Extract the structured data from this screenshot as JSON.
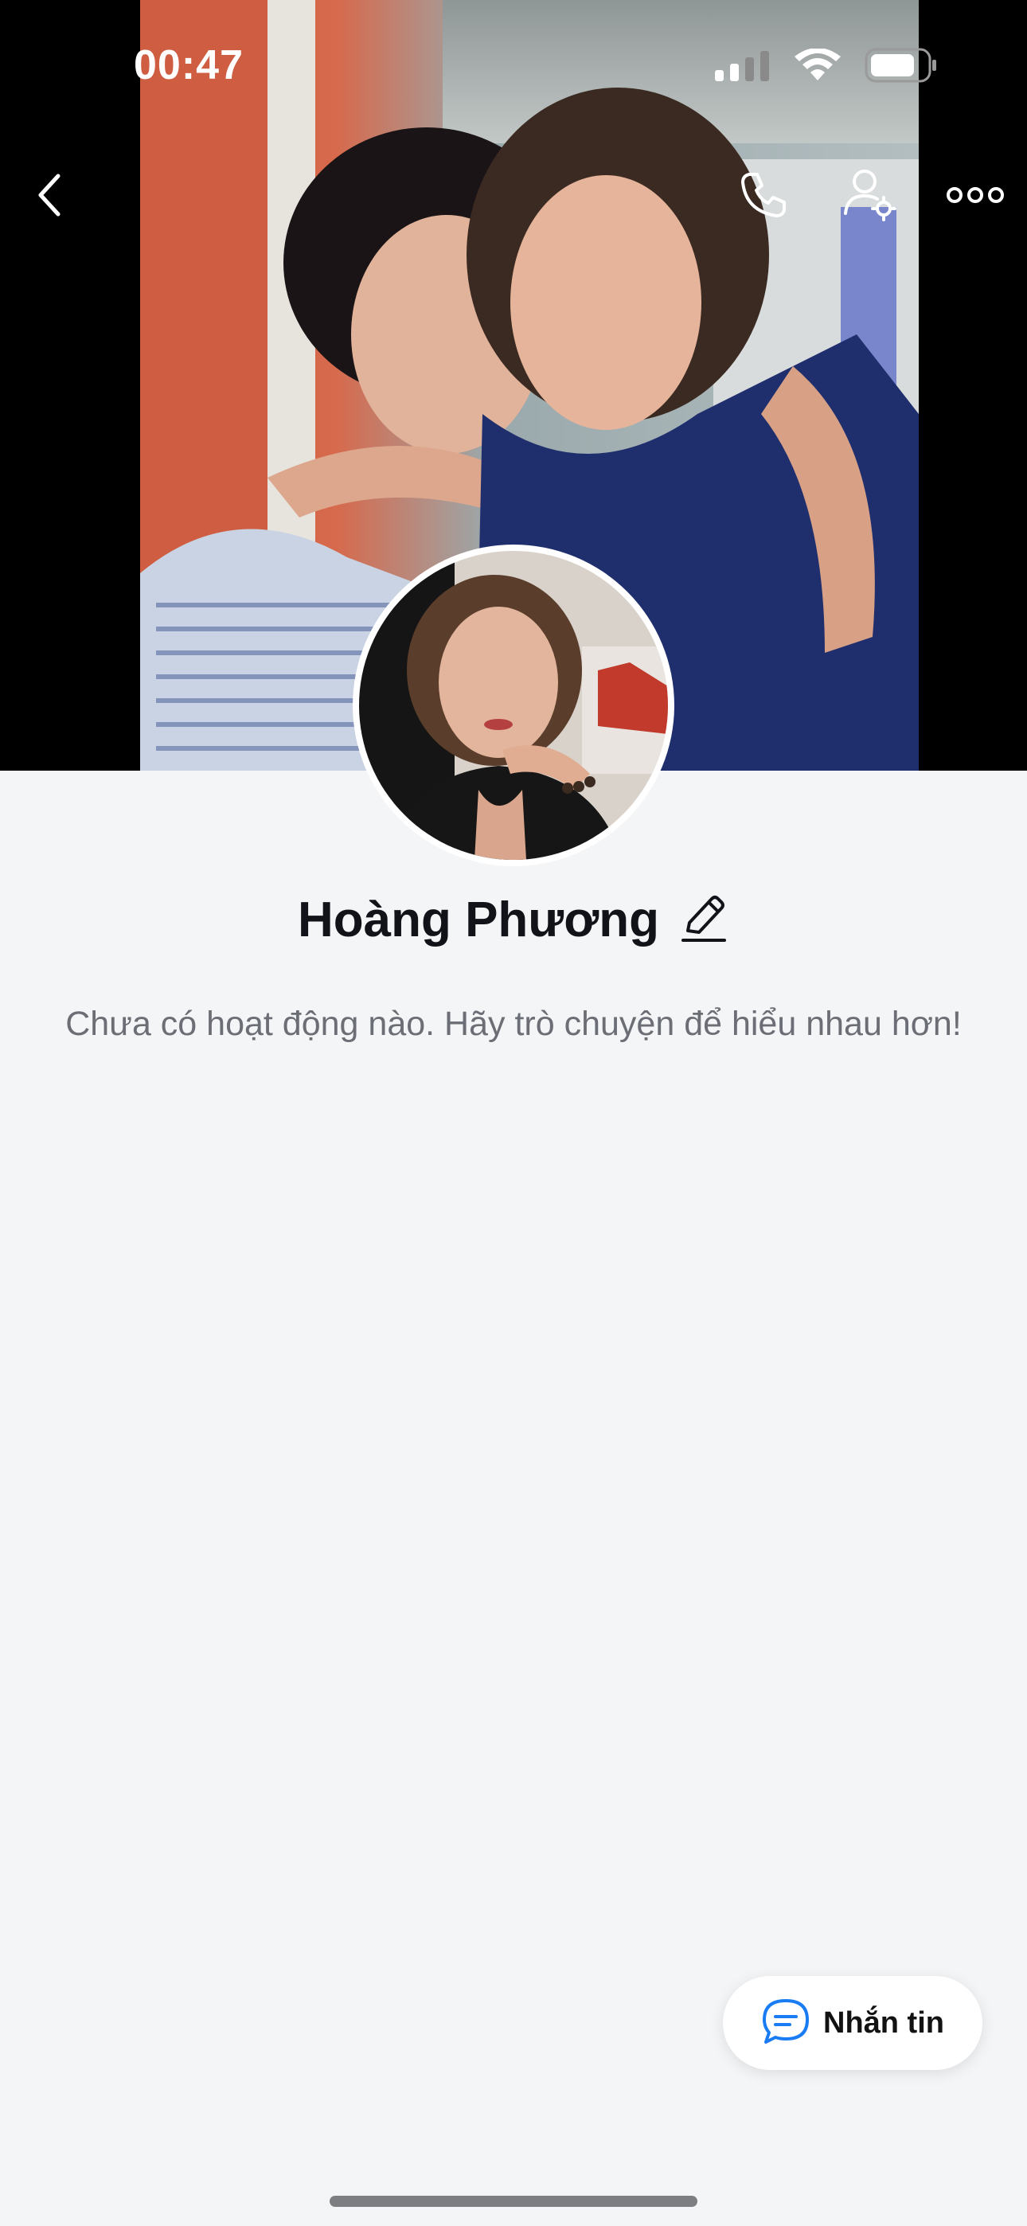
{
  "status_bar": {
    "time": "00:47",
    "icons": [
      "signal-icon",
      "wifi-icon",
      "battery-icon"
    ]
  },
  "top_nav": {
    "back_icon": "back-chevron-icon",
    "call_icon": "phone-icon",
    "settings_icon": "user-settings-icon",
    "more_icon": "more-icon"
  },
  "profile": {
    "name": "Hoàng Phương",
    "edit_icon": "pencil-icon",
    "empty_message": "Chưa có hoạt động nào. Hãy trò chuyện để hiểu nhau hơn!"
  },
  "actions": {
    "message_label": "Nhắn tin",
    "message_icon": "chat-bubble-icon"
  },
  "colors": {
    "accent": "#1a7cf2",
    "background": "#f4f5f7",
    "cover_bg": "#000000"
  }
}
